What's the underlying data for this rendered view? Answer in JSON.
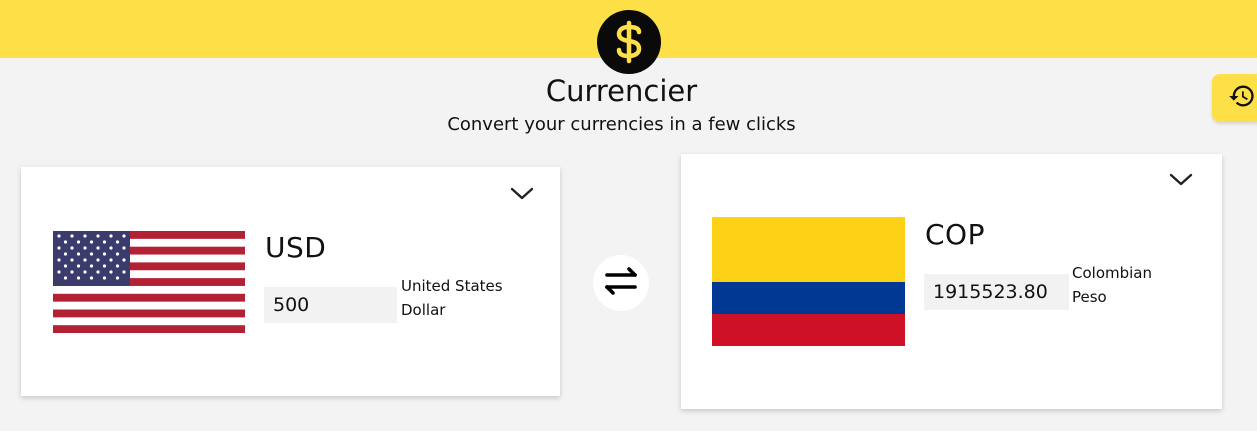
{
  "app": {
    "title": "Currencier",
    "subtitle": "Convert your currencies in a few clicks",
    "logo_icon": "dollar-sign-icon",
    "accent_color": "#fde047",
    "background_color": "#f3f3f3"
  },
  "history_button": {
    "icon": "history-icon"
  },
  "swap_button": {
    "icon": "swap-arrows-icon"
  },
  "from": {
    "code": "USD",
    "amount": "500",
    "name_line1": "United States",
    "name_line2": "Dollar",
    "flag": "us-flag-icon",
    "dropdown_icon": "chevron-down-icon"
  },
  "to": {
    "code": "COP",
    "amount": "1915523.80",
    "name_line1": "Colombian",
    "name_line2": "Peso",
    "flag": "colombia-flag-icon",
    "dropdown_icon": "chevron-down-icon"
  }
}
